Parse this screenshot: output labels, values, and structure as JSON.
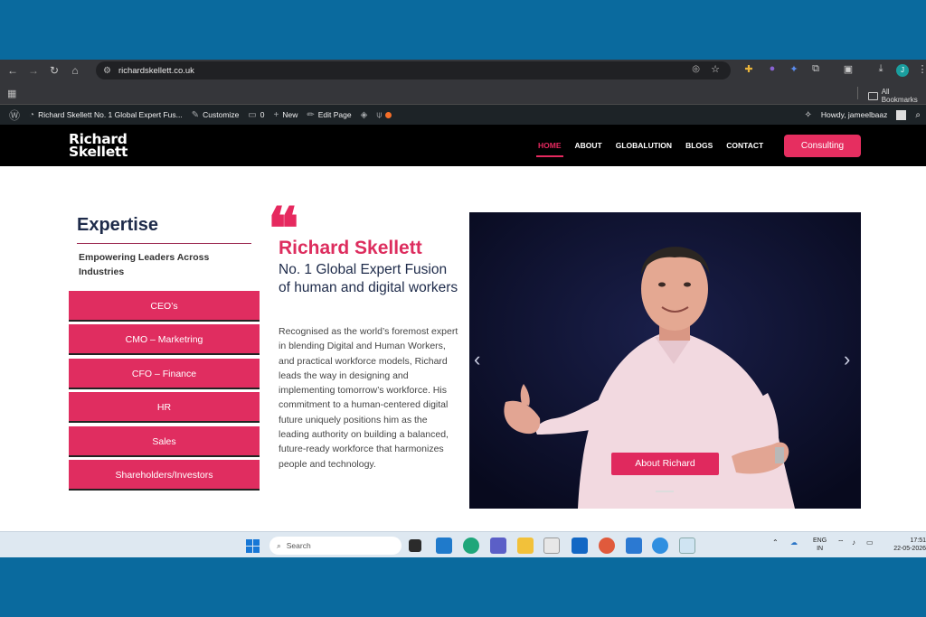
{
  "browser": {
    "url": "richardskellett.co.uk",
    "extension_badge": "44",
    "profile_initial": "J",
    "bookmarks_folder": "All Bookmarks"
  },
  "wpbar": {
    "site_title": "Richard Skellett No. 1 Global Expert Fus...",
    "customize": "Customize",
    "comments": "0",
    "new": "New",
    "edit_page": "Edit Page",
    "howdy": "Howdy, jameelbaaz"
  },
  "site": {
    "logo_line1": "Richard",
    "logo_line2": "Skellett",
    "nav": [
      {
        "label": "HOME",
        "active": true
      },
      {
        "label": "ABOUT"
      },
      {
        "label": "GLOBALUTION"
      },
      {
        "label": "BLOGS"
      },
      {
        "label": "CONTACT"
      }
    ],
    "cta": "Consulting",
    "accent": "#e6295f"
  },
  "expertise": {
    "title": "Expertise",
    "subtitle": "Empowering Leaders Across Industries",
    "items": [
      "CEO’s",
      "CMO – Marketring",
      "CFO – Finance",
      "HR",
      "Sales",
      "Shareholders/Investors"
    ]
  },
  "intro": {
    "quote_mark": "❝",
    "name": "Richard Skellett",
    "tagline": "No. 1 Global Expert Fusion of human and digital workers",
    "bio": "Recognised as the world’s foremost expert in blending Digital and Human Workers, and practical workforce models, Richard leads the way in designing and implementing tomorrow’s workforce. His commitment to a human-centered digital future uniquely positions him as the leading authority on building a balanced, future-ready workforce that harmonizes people and technology."
  },
  "slider": {
    "button": "About Richard",
    "prev": "‹",
    "next": "›"
  },
  "taskbar": {
    "search_placeholder": "Search",
    "lang_line1": "ENG",
    "lang_line2": "IN",
    "time": "17:51",
    "date": "22-05-2026"
  }
}
